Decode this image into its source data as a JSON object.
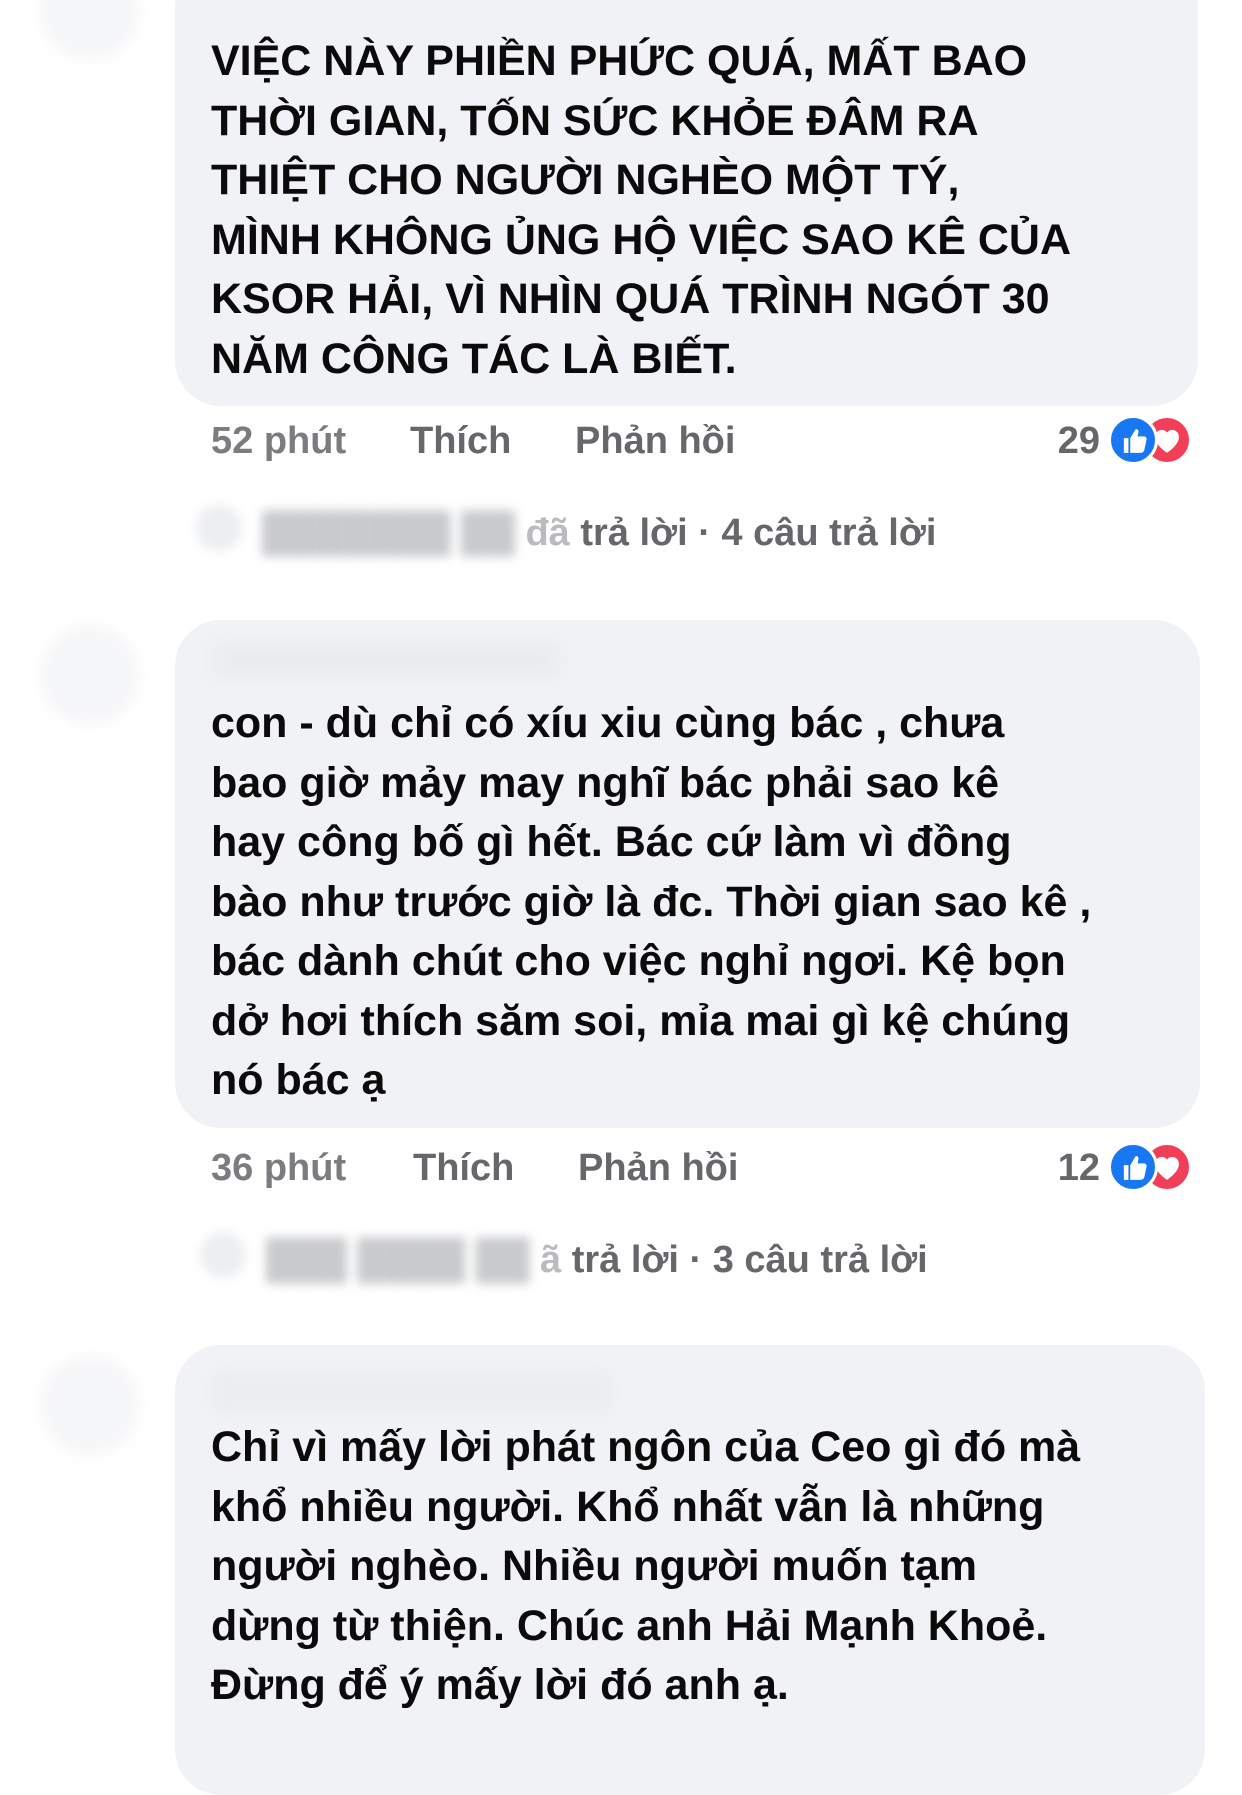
{
  "comments": [
    {
      "text": "VIỆC NÀY PHIỀN PHỨC QUÁ, MẤT BAO\nTHỜI GIAN, TỐN SỨC KHỎE ĐÂM RA\nTHIỆT CHO NGƯỜI NGHÈO MỘT TÝ,\nMÌNH KHÔNG ỦNG HỘ VIỆC SAO KÊ CỦA\nKSOR HẢI, VÌ NHÌN QUÁ TRÌNH NGÓT 30\nNĂM CÔNG TÁC LÀ BIẾT.",
      "time": "52 phút",
      "like_label": "Thích",
      "reply_label": "Phản hồi",
      "reaction_count": "29",
      "replies_prefix_visible": "trả lời",
      "replies_prefix_faded": "đã",
      "replies_count": "· 4 câu trả lời"
    },
    {
      "text": "con  - dù chỉ có xíu xiu cùng bác , chưa\nbao giờ mảy may nghĩ bác phải sao kê\nhay công bố gì hết. Bác cứ làm vì đồng\nbào như trước giờ là đc. Thời gian sao kê ,\nbác dành chút cho việc nghỉ ngơi. Kệ bọn\ndở hơi thích săm soi, mỉa mai gì kệ chúng\nnó bác ạ",
      "time": "36 phút",
      "like_label": "Thích",
      "reply_label": "Phản hồi",
      "reaction_count": "12",
      "replies_prefix_visible": "trả lời",
      "replies_prefix_faded": "ã",
      "replies_count": "· 3 câu trả lời"
    },
    {
      "text": "Chỉ vì mấy lời phát ngôn của Ceo gì đó mà\nkhổ nhiều người. Khổ nhất vẫn là những\nngười nghèo. Nhiều người muốn tạm\ndừng từ thiện. Chúc anh Hải Mạnh Khoẻ.\nĐừng để ý mấy lời đó anh ạ."
    }
  ],
  "icons": {
    "like": "thumbs-up-icon",
    "love": "heart-icon"
  },
  "colors": {
    "bubble": "#f0f2f5",
    "like": "#1877f2",
    "love": "#f33e58",
    "meta_text": "#65676b"
  }
}
